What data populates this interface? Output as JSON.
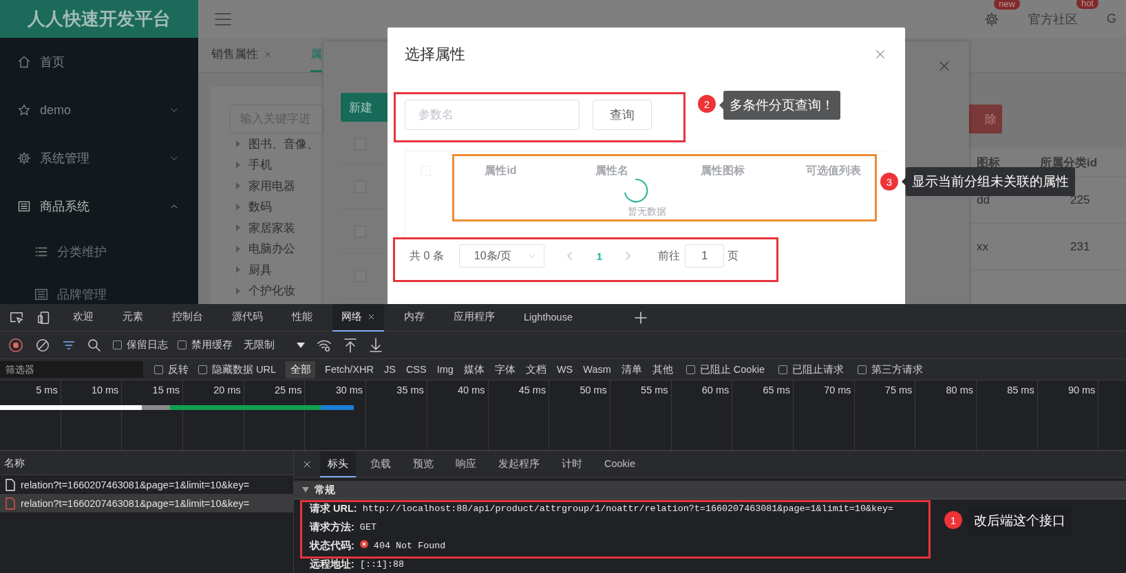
{
  "app": {
    "logo": "人人快速开发平台",
    "sidebar": {
      "items": [
        {
          "label": "首页"
        },
        {
          "label": "demo",
          "expanded": false
        },
        {
          "label": "系统管理",
          "expanded": false
        },
        {
          "label": "商品系统",
          "expanded": true,
          "children": [
            {
              "label": "分类维护"
            },
            {
              "label": "品牌管理"
            }
          ]
        }
      ]
    },
    "header": {
      "settings_badge": "new",
      "links": [
        {
          "label": "官方社区",
          "badge": "hot"
        },
        {
          "label": "G"
        }
      ]
    },
    "page_tabs": [
      {
        "label": "销售属性",
        "selected": false,
        "closable": true
      },
      {
        "label": "属",
        "selected": true
      }
    ],
    "category_tree": {
      "search_placeholder": "输入关键字进",
      "items": [
        {
          "label": "图书、音像、",
          "expanded": false
        },
        {
          "label": "手机",
          "expanded": false
        },
        {
          "label": "家用电器",
          "expanded": false
        },
        {
          "label": "数码",
          "expanded": false
        },
        {
          "label": "家居家装",
          "expanded": false
        },
        {
          "label": "电脑办公",
          "expanded": false
        },
        {
          "label": "厨具",
          "expanded": false
        },
        {
          "label": "个护化妆",
          "expanded": false
        }
      ]
    },
    "side_table": {
      "delete_button": "除",
      "columns": [
        "图标",
        "所属分类id"
      ],
      "rows": [
        [
          "dd",
          "225"
        ],
        [
          "xx",
          "231"
        ]
      ]
    },
    "relation_dialog": {
      "new_button": "新建",
      "checkboxes": [
        {
          "checked": false
        },
        {
          "checked": false
        },
        {
          "checked": false
        },
        {
          "checked": false
        }
      ]
    }
  },
  "attr_dialog": {
    "title": "选择属性",
    "search": {
      "placeholder": "参数名"
    },
    "query_button": "查询",
    "select_all": {
      "checked": false
    },
    "columns": [
      "属性id",
      "属性名",
      "属性图标",
      "可选值列表"
    ],
    "loading": true,
    "empty_text": "暂无数据",
    "pagination": {
      "total": "共 0 条",
      "page_size": "10条/页",
      "pages": [
        {
          "label": "1",
          "selected": true
        }
      ],
      "goto_label": "前往",
      "goto_value": "1",
      "goto_suffix": "页"
    }
  },
  "annotations": [
    {
      "number": "2",
      "text": "多条件分页查询！",
      "color": "#e8333c"
    },
    {
      "number": "3",
      "text": "显示当前分组未关联的属性",
      "color": "#ee8c32"
    },
    {
      "color": "#e8333c"
    },
    {
      "number": "1",
      "text": "改后端这个接口",
      "color": "#e8333c"
    }
  ],
  "devtools": {
    "tabs": [
      {
        "label": "欢迎",
        "selected": false
      },
      {
        "label": "元素",
        "selected": false
      },
      {
        "label": "控制台",
        "selected": false
      },
      {
        "label": "源代码",
        "selected": false
      },
      {
        "label": "性能",
        "selected": false
      },
      {
        "label": "网络",
        "selected": true,
        "closable": true
      },
      {
        "label": "内存",
        "selected": false
      },
      {
        "label": "应用程序",
        "selected": false
      },
      {
        "label": "Lighthouse",
        "selected": false
      }
    ],
    "toolbar": {
      "options": [
        {
          "label": "保留日志",
          "checked": false
        },
        {
          "label": "禁用缓存",
          "checked": false
        }
      ],
      "throttle": "无限制"
    },
    "filter": {
      "placeholder": "筛选器",
      "options": [
        {
          "label": "反转",
          "checked": false
        },
        {
          "label": "隐藏数据 URL",
          "checked": false
        }
      ],
      "types": [
        {
          "label": "全部",
          "selected": true
        },
        {
          "label": "Fetch/XHR",
          "selected": false
        },
        {
          "label": "JS",
          "selected": false
        },
        {
          "label": "CSS",
          "selected": false
        },
        {
          "label": "Img",
          "selected": false
        },
        {
          "label": "媒体",
          "selected": false
        },
        {
          "label": "字体",
          "selected": false
        },
        {
          "label": "文档",
          "selected": false
        },
        {
          "label": "WS",
          "selected": false
        },
        {
          "label": "Wasm",
          "selected": false
        },
        {
          "label": "清单",
          "selected": false
        },
        {
          "label": "其他",
          "selected": false
        }
      ],
      "extra_options": [
        {
          "label": "已阻止 Cookie",
          "checked": false
        },
        {
          "label": "已阻止请求",
          "checked": false
        },
        {
          "label": "第三方请求",
          "checked": false
        }
      ]
    },
    "timeline": {
      "ticks": [
        "5 ms",
        "10 ms",
        "15 ms",
        "20 ms",
        "25 ms",
        "30 ms",
        "35 ms",
        "40 ms",
        "45 ms",
        "50 ms",
        "55 ms",
        "60 ms",
        "65 ms",
        "70 ms",
        "75 ms",
        "80 ms",
        "85 ms",
        "90 ms"
      ]
    },
    "requests": {
      "column": "名称",
      "rows": [
        {
          "name": "relation?t=1660207463081&page=1&limit=10&key=",
          "selected": false,
          "failed": false
        },
        {
          "name": "relation?t=1660207463081&page=1&limit=10&key=",
          "selected": true,
          "failed": true
        }
      ]
    },
    "details": {
      "tabs": [
        {
          "label": "标头",
          "selected": true
        },
        {
          "label": "负载",
          "selected": false
        },
        {
          "label": "预览",
          "selected": false
        },
        {
          "label": "响应",
          "selected": false
        },
        {
          "label": "发起程序",
          "selected": false
        },
        {
          "label": "计时",
          "selected": false
        },
        {
          "label": "Cookie",
          "selected": false
        }
      ],
      "section": {
        "title": "常规",
        "expanded": true
      },
      "fields": [
        {
          "label": "请求 URL:",
          "value": "http://localhost:88/api/product/attrgroup/1/noattr/relation?t=1660207463081&page=1&limit=10&key="
        },
        {
          "label": "请求方法:",
          "value": "GET"
        },
        {
          "label": "状态代码:",
          "value": "404 Not Found",
          "error": true
        },
        {
          "label": "远程地址:",
          "value": "[::1]:88"
        }
      ]
    }
  }
}
